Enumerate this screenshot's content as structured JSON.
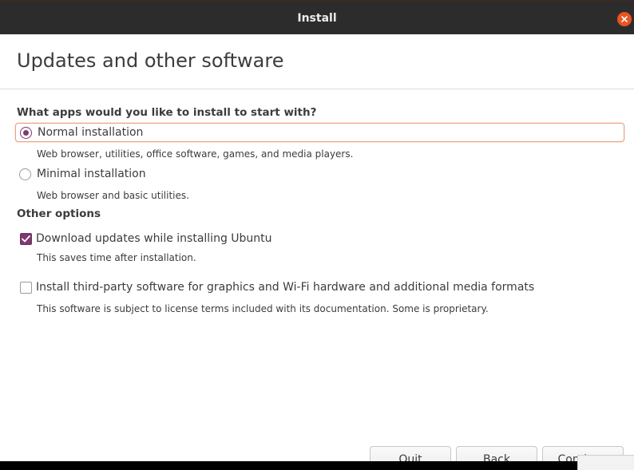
{
  "window": {
    "title": "Install"
  },
  "page": {
    "title": "Updates and other software"
  },
  "install_section": {
    "heading": "What apps would you like to install to start with?",
    "options": [
      {
        "label": "Normal installation",
        "description": "Web browser, utilities, office software, games, and media players.",
        "selected": true
      },
      {
        "label": "Minimal installation",
        "description": "Web browser and basic utilities.",
        "selected": false
      }
    ]
  },
  "other_section": {
    "heading": "Other options",
    "options": [
      {
        "label": "Download updates while installing Ubuntu",
        "description": "This saves time after installation.",
        "checked": true
      },
      {
        "label": "Install third-party software for graphics and Wi-Fi hardware and additional media formats",
        "description": "This software is subject to license terms included with its documentation. Some is proprietary.",
        "checked": false
      }
    ]
  },
  "buttons": {
    "quit": "Quit",
    "back": "Back",
    "continue": "Continue"
  },
  "colors": {
    "accent": "#7d3a6e",
    "close": "#e95420",
    "titlebar": "#2c2c2c"
  },
  "icons": {
    "close": "close-icon",
    "check": "checkmark-icon"
  }
}
